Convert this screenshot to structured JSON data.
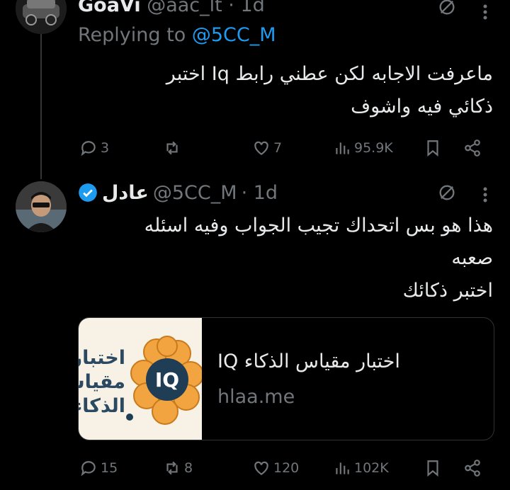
{
  "tweet1": {
    "display_name": "GoaVi",
    "handle_time": "@aac_lt · 1d",
    "replying_prefix": "Replying to ",
    "replying_handle": "@5CC_M",
    "text_line1": "ماعرفت الاجابه لكن عطني رابط Iq اختبر",
    "text_line2": "ذكائي فيه واشوف",
    "actions": {
      "replies": "3",
      "retweets": "",
      "likes": "7",
      "views": "95.9K"
    }
  },
  "tweet2": {
    "display_name": "عادل",
    "handle": "@5CC_M",
    "time": "· 1d",
    "text_line1": "هذا هو بس اتحداك تجيب الجواب وفيه اسئله",
    "text_line2": "صعبه",
    "text_line3": "اختبر ذكائك",
    "card": {
      "title": "اختبار مقياس الذكاء IQ",
      "domain": "hlaa.me",
      "thumb_badge": "IQ",
      "thumb_text_line1": "اختبار",
      "thumb_text_line2": "مقياس",
      "thumb_text_line3": "الذكاء"
    },
    "actions": {
      "replies": "15",
      "retweets": "8",
      "likes": "120",
      "views": "102K"
    }
  },
  "colors": {
    "background": "#000000",
    "accent": "#1d9bf0",
    "muted": "#71767b",
    "text": "#e7e9ea",
    "verified": "#1d9bf0"
  }
}
